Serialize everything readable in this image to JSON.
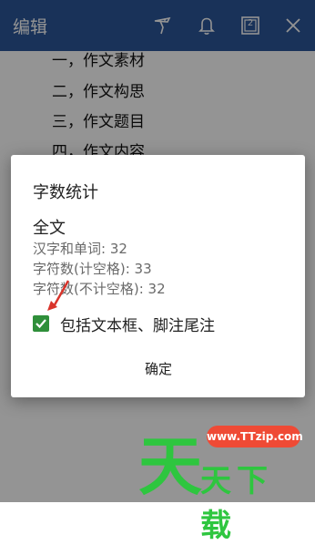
{
  "appbar": {
    "title": "编辑",
    "icons": [
      "pen-icon",
      "bell-icon",
      "window-2-icon",
      "close-icon"
    ],
    "window_count": "2"
  },
  "document": {
    "lines": [
      "一，作文素材",
      "二，作文构思",
      "三，作文题目",
      "四，作文内容"
    ]
  },
  "dialog": {
    "title": "字数统计",
    "section": "全文",
    "stats": [
      "汉字和单词: 32",
      "字符数(计空格): 33",
      "字符数(不计空格): 32"
    ],
    "checkbox_label": "包括文本框、脚注尾注",
    "checkbox_checked": true,
    "ok_label": "确定"
  },
  "watermark": {
    "badge": "www.TTzip.com",
    "big_char": "天",
    "small_text": "天下载"
  },
  "colors": {
    "appbar": "#2b579a",
    "checkbox": "#2f8f3a",
    "watermark_green": "#2ec63f",
    "watermark_red": "#ef4a35",
    "arrow": "#d9342b"
  }
}
